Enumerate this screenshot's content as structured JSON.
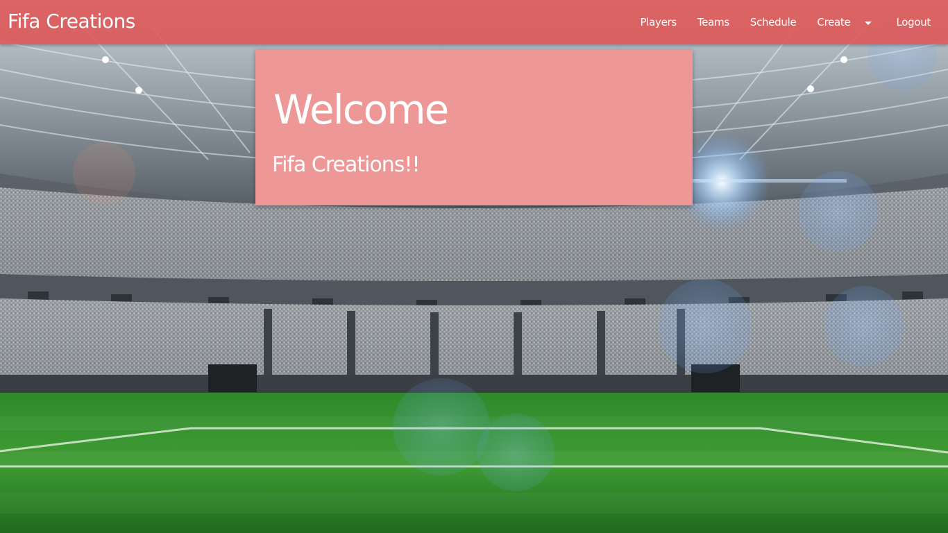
{
  "navbar": {
    "brand": "Fifa Creations",
    "links": {
      "players": "Players",
      "teams": "Teams",
      "schedule": "Schedule",
      "create": "Create",
      "logout": "Logout"
    }
  },
  "hero": {
    "title": "Welcome",
    "subtitle": "Fifa Creations!!"
  },
  "theme": {
    "navbar_color": "#de5252",
    "card_color": "#ee9797",
    "text_color": "#ffffff"
  },
  "background": {
    "scene": "football-stadium-background"
  }
}
